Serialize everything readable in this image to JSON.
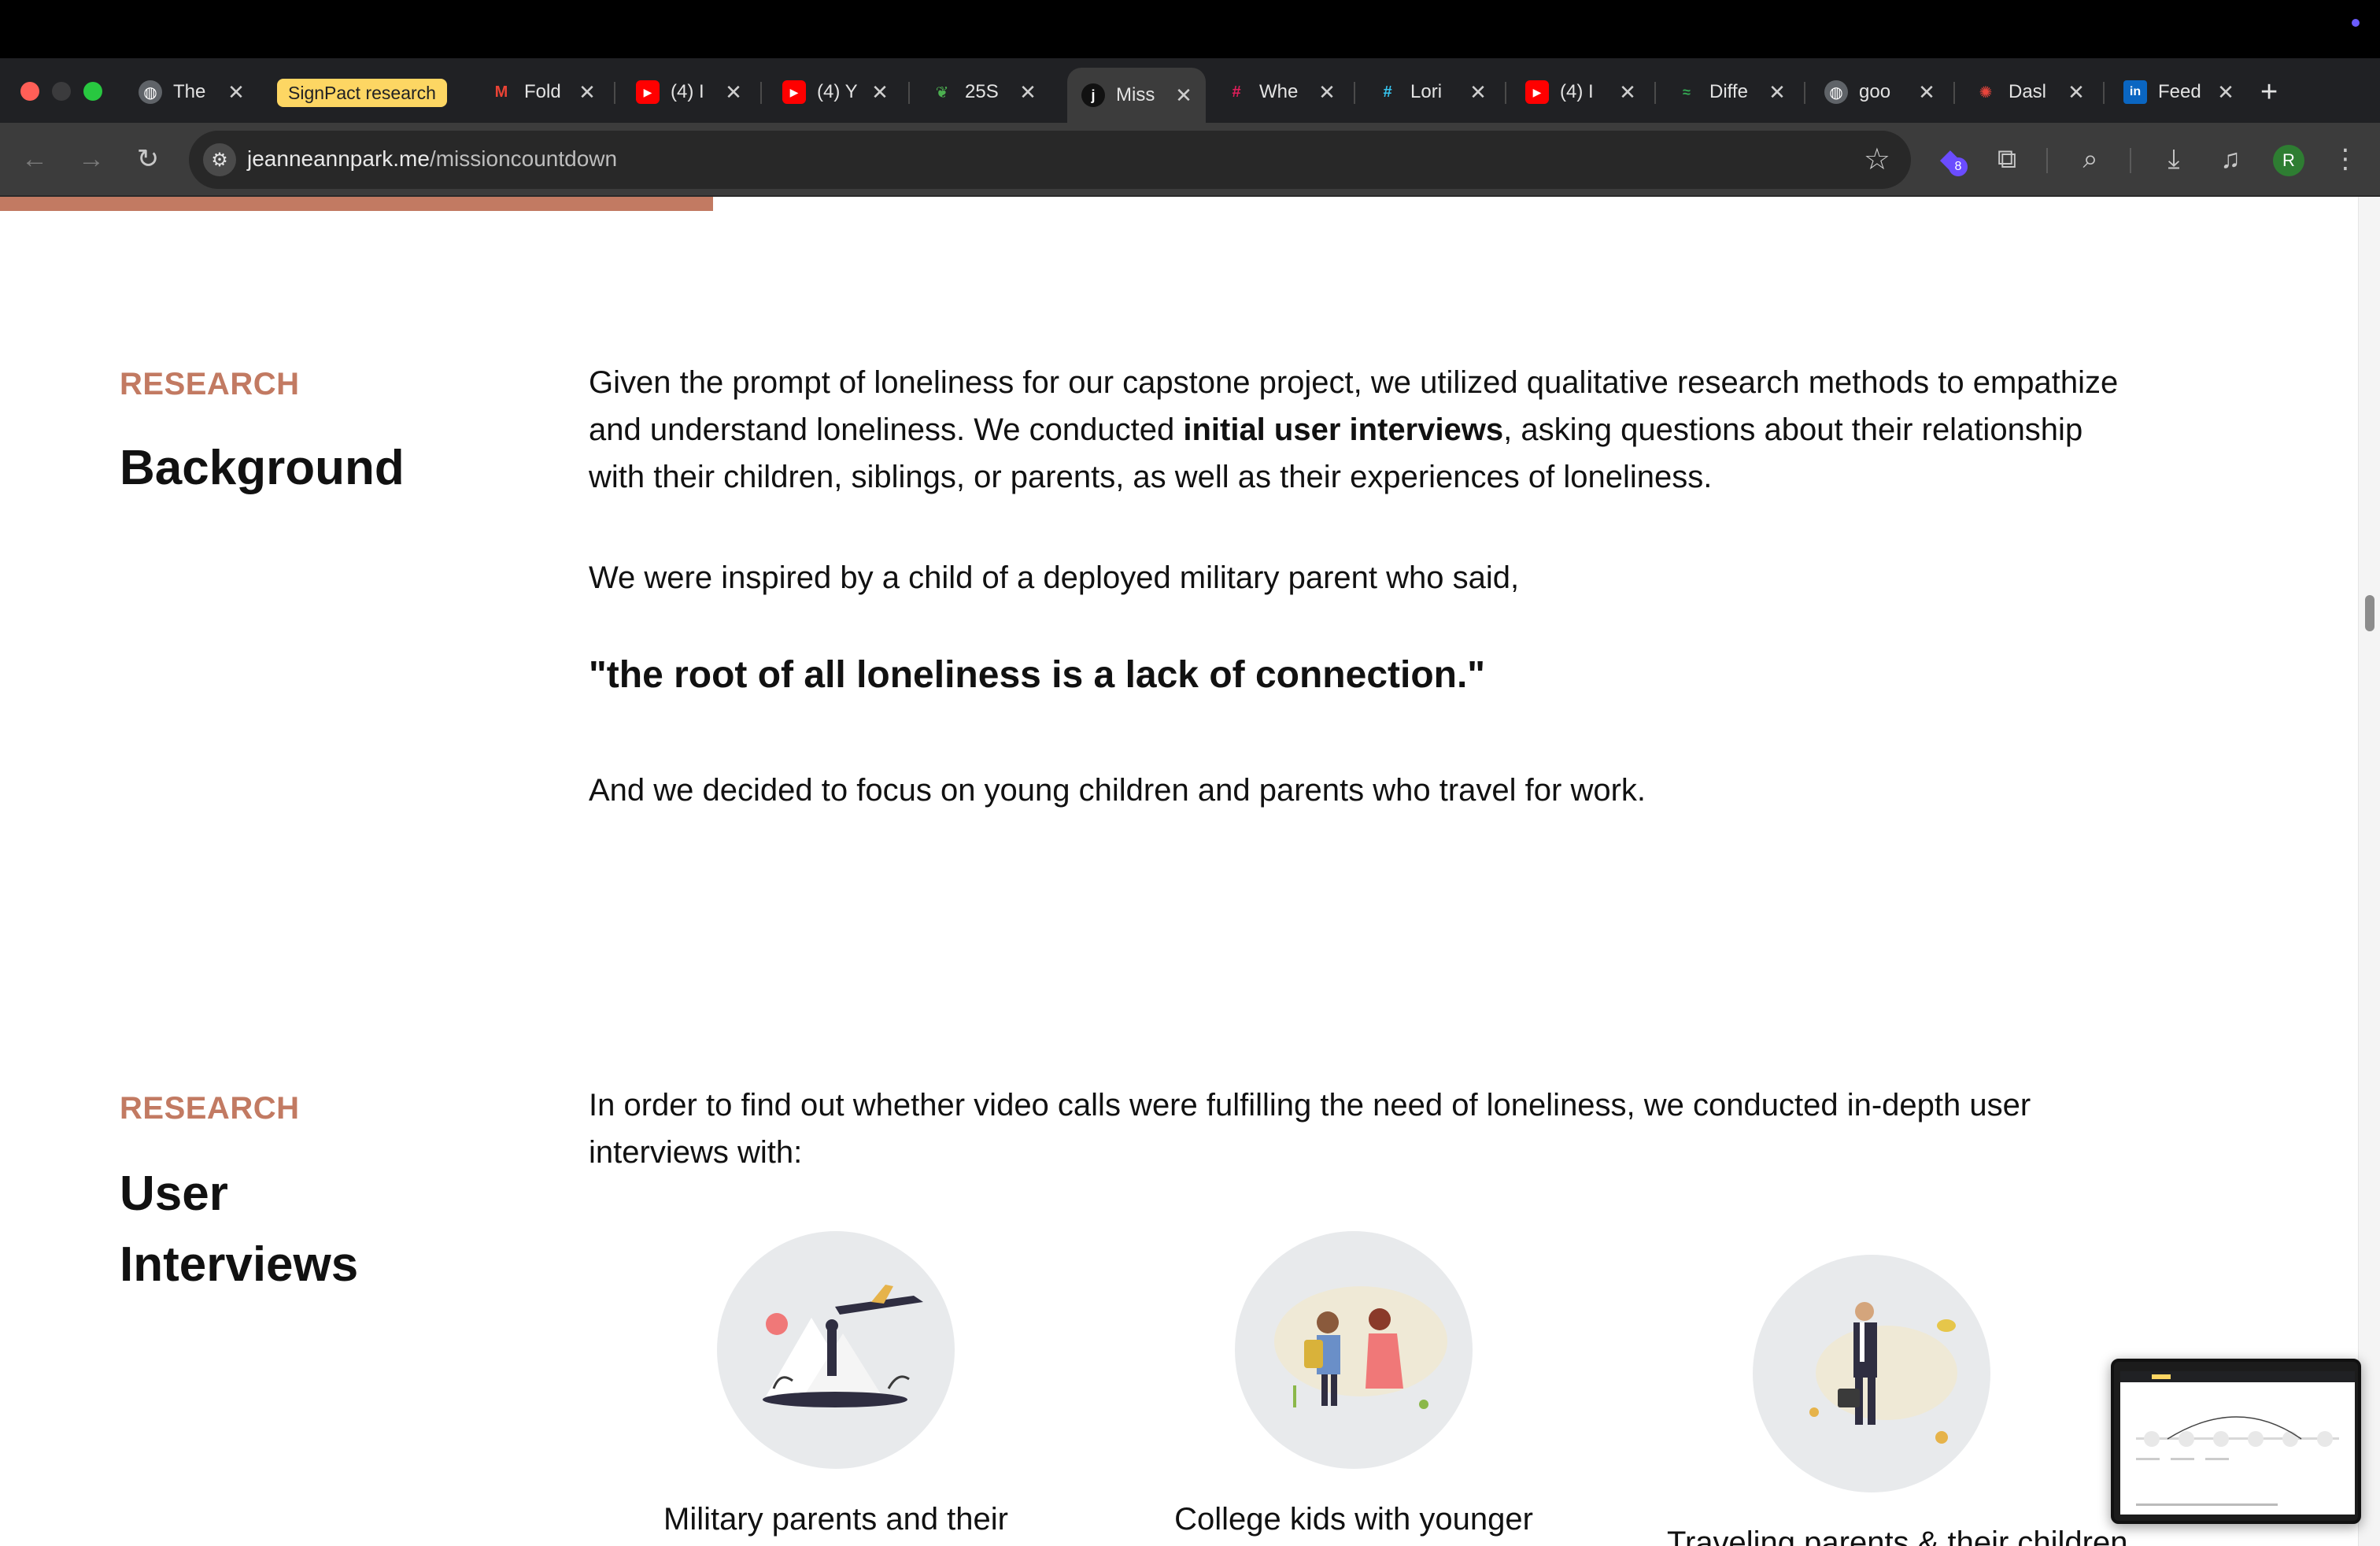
{
  "browser": {
    "tabs": [
      {
        "title": "The",
        "favicon": "globe-icon",
        "active": false
      },
      {
        "title": "SignPact research",
        "favicon": "tab-group-chip",
        "active": false
      },
      {
        "title": "Fold",
        "favicon": "gmail-icon",
        "active": false
      },
      {
        "title": "(4) I",
        "favicon": "youtube-icon",
        "active": false
      },
      {
        "title": "(4) Y",
        "favicon": "youtube-icon",
        "active": false
      },
      {
        "title": "25S",
        "favicon": "leaf-icon",
        "active": false
      },
      {
        "title": "Miss",
        "favicon": "j-icon",
        "active": true
      },
      {
        "title": "Whe",
        "favicon": "slack-icon",
        "active": false
      },
      {
        "title": "Lori",
        "favicon": "slack-icon",
        "active": false
      },
      {
        "title": "(4) I",
        "favicon": "youtube-icon",
        "active": false
      },
      {
        "title": "Diffe",
        "favicon": "diff-icon",
        "active": false
      },
      {
        "title": "goo",
        "favicon": "globe-icon",
        "active": false
      },
      {
        "title": "Dasl",
        "favicon": "dashboard-icon",
        "active": false
      },
      {
        "title": "Feed",
        "favicon": "linkedin-icon",
        "active": false
      }
    ],
    "tab_group_label": "SignPact research",
    "url_domain": "jeanneannpark.me",
    "url_path": "/missioncountdown",
    "extension_badge": "8",
    "profile_initial": "R",
    "colors": {
      "chrome_dark": "#202124",
      "toolbar": "#3c3c3c",
      "group_chip": "#fdd663"
    }
  },
  "page": {
    "accent_color": "#c27a62",
    "background": {
      "eyebrow": "RESEARCH",
      "title": "Background",
      "para1_before": "Given the prompt of loneliness for our capstone project, we utilized qualitative research methods to empathize and understand loneliness. We conducted ",
      "para1_bold": "initial user interviews",
      "para1_after": ", asking questions about their relationship with their children, siblings, or parents, as well as their experiences of loneliness.",
      "para2": "We were inspired by a child of a deployed military parent who said,",
      "quote": "\"the root of all loneliness is a lack of connection.\"",
      "para3": "And we decided to focus on young children and parents who travel for work."
    },
    "interviews": {
      "eyebrow": "RESEARCH",
      "title_line1": "User",
      "title_line2": "Interviews",
      "intro": "In order to find out whether video calls were fulfilling the need of loneliness, we conducted in-depth user interviews with:",
      "personas": [
        {
          "caption": "Military parents and their",
          "illustration": "airplane-illustration"
        },
        {
          "caption": "College kids with younger",
          "illustration": "parent-child-illustration"
        },
        {
          "caption": "Traveling parents & their children",
          "illustration": "businessman-illustration"
        }
      ]
    }
  }
}
